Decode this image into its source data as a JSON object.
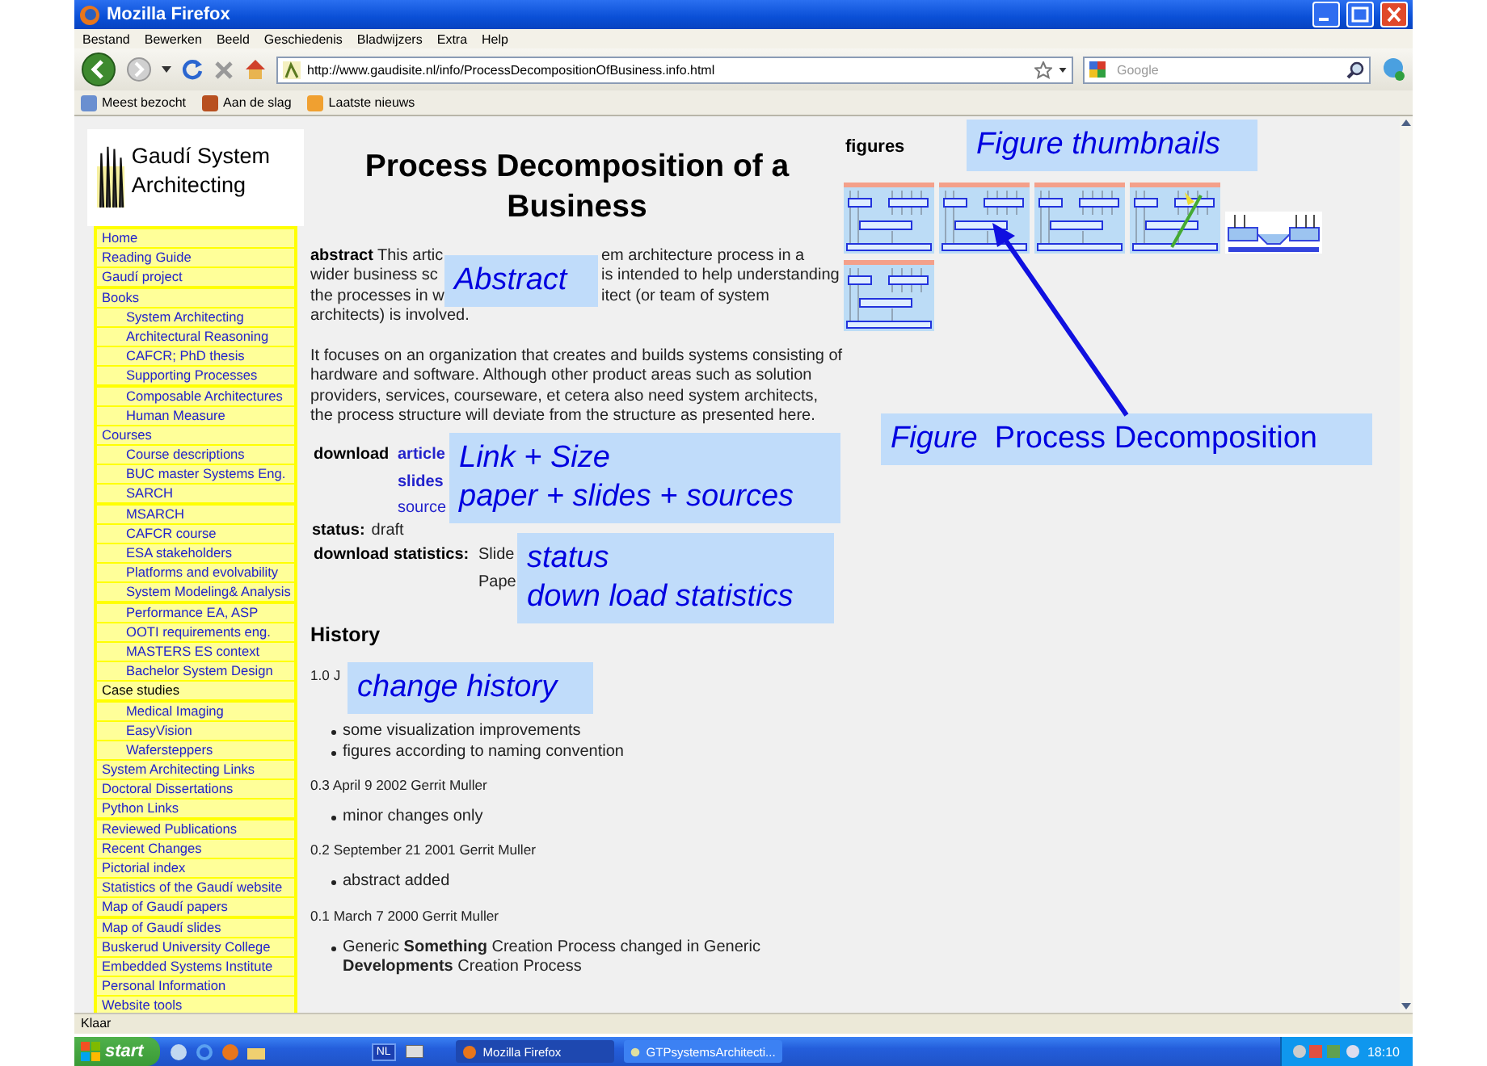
{
  "window": {
    "title": "Mozilla Firefox"
  },
  "menu": [
    "Bestand",
    "Bewerken",
    "Beeld",
    "Geschiedenis",
    "Bladwijzers",
    "Extra",
    "Help"
  ],
  "address": {
    "value": "http://www.gaudisite.nl/info/ProcessDecompositionOfBusiness.info.html"
  },
  "search": {
    "placeholder": "Google"
  },
  "bookmarks": [
    "Meest bezocht",
    "Aan de slag",
    "Laatste nieuws"
  ],
  "sidebar": {
    "logo_text": "Gaudí System Architecting",
    "items": [
      {
        "label": "Home",
        "kind": "link"
      },
      {
        "label": "Reading Guide",
        "kind": "link"
      },
      {
        "label": "Gaudí project",
        "kind": "link"
      },
      {
        "label": "Books",
        "kind": "link",
        "children": [
          {
            "label": "System Architecting",
            "kind": "link"
          },
          {
            "label": "Architectural Reasoning",
            "kind": "link"
          },
          {
            "label": "CAFCR; PhD thesis",
            "kind": "link"
          },
          {
            "label": "Supporting Processes",
            "kind": "link"
          },
          {
            "label": "Composable Architectures",
            "kind": "link"
          },
          {
            "label": "Human Measure",
            "kind": "link"
          }
        ]
      },
      {
        "label": "Courses",
        "kind": "link",
        "children": [
          {
            "label": "Course descriptions",
            "kind": "link"
          },
          {
            "label": "BUC master Systems Eng.",
            "kind": "link"
          },
          {
            "label": "SARCH",
            "kind": "link"
          },
          {
            "label": "MSARCH",
            "kind": "link"
          },
          {
            "label": "CAFCR course",
            "kind": "link"
          },
          {
            "label": "ESA stakeholders",
            "kind": "link"
          },
          {
            "label": "Platforms and evolvability",
            "kind": "link"
          },
          {
            "label": "System Modeling& Analysis",
            "kind": "link"
          },
          {
            "label": "Performance EA, ASP",
            "kind": "link"
          },
          {
            "label": "OOTI requirements eng.",
            "kind": "link"
          },
          {
            "label": "MASTERS ES context",
            "kind": "link"
          },
          {
            "label": "Bachelor System Design",
            "kind": "link"
          }
        ]
      },
      {
        "label": "Case studies",
        "kind": "text",
        "children": [
          {
            "label": "Medical Imaging",
            "kind": "link"
          },
          {
            "label": "EasyVision",
            "kind": "link"
          },
          {
            "label": "Wafersteppers",
            "kind": "link"
          }
        ]
      },
      {
        "label": "System Architecting Links",
        "kind": "link"
      },
      {
        "label": "Doctoral Dissertations",
        "kind": "link"
      },
      {
        "label": "Python Links",
        "kind": "link"
      },
      {
        "label": "Reviewed Publications",
        "kind": "link"
      },
      {
        "label": "Recent Changes",
        "kind": "link"
      },
      {
        "label": "Pictorial index",
        "kind": "link"
      },
      {
        "label": "Statistics of the Gaudí website",
        "kind": "link"
      },
      {
        "label": "Map of Gaudí papers",
        "kind": "link"
      },
      {
        "label": "Map of Gaudí slides",
        "kind": "link"
      },
      {
        "label": "Buskerud University College",
        "kind": "link"
      },
      {
        "label": "Embedded Systems Institute",
        "kind": "link"
      },
      {
        "label": "Personal Information",
        "kind": "link"
      },
      {
        "label": "Website tools",
        "kind": "link"
      }
    ]
  },
  "article": {
    "title": "Process Decomposition of a Business",
    "abstract": {
      "label": "abstract",
      "lines": [
        [
          "This artic",
          "em architecture process in a"
        ],
        [
          "wider business sc",
          "is intended to help understanding"
        ],
        [
          "the processes in w",
          "itect (or team of system"
        ],
        [
          "architects) is involved."
        ]
      ]
    },
    "paragraph": "It focuses on an organization that creates and builds systems consisting of hardware and software. Although other product areas such as solution providers, services, courseware, et cetera also need system architects, the process structure will deviate from the structure as presented here.",
    "download": {
      "label": "download",
      "links": [
        {
          "text": "article",
          "bold": true
        },
        {
          "text": "slides",
          "bold": true
        },
        {
          "text": "source",
          "bold": false
        }
      ]
    },
    "status": {
      "label": "status:",
      "value": "draft"
    },
    "download_statistics": {
      "label": "download statistics:",
      "values": [
        "Slide",
        "Pape"
      ]
    },
    "history": {
      "title": "History",
      "entries": [
        {
          "heading": "1.0 J",
          "items": [
            {
              "text": "some visualization improvements"
            },
            {
              "text": "figures according to naming convention"
            }
          ]
        },
        {
          "heading": "0.3 April 9 2002 Gerrit Muller",
          "items": [
            {
              "text": "minor changes only"
            }
          ]
        },
        {
          "heading": "0.2 September 21 2001 Gerrit Muller",
          "items": [
            {
              "text": "abstract added"
            }
          ]
        },
        {
          "heading": "0.1 March 7 2000 Gerrit Muller",
          "items": [
            {
              "text": "Generic **Something** Creation Process changed in Generic **Developments** Creation Process"
            }
          ]
        }
      ]
    }
  },
  "figures": {
    "title": "figures",
    "thumbnails": [
      {
        "kind": "diagram"
      },
      {
        "kind": "diagram"
      },
      {
        "kind": "diagram"
      },
      {
        "kind": "annotated"
      },
      {
        "kind": "wide"
      },
      {
        "kind": "diagram"
      }
    ]
  },
  "status_bar": "Klaar",
  "callouts": [
    {
      "lines": [
        "Abstract"
      ]
    },
    {
      "lines": [
        "Link + Size",
        "paper + slides + sources"
      ]
    },
    {
      "lines": [
        "status",
        "down load statistics"
      ]
    },
    {
      "lines": [
        "change history"
      ]
    },
    {
      "lines": [
        "Figure thumbnails"
      ]
    },
    {
      "lines": [
        "*Figure*  Process Decomposition"
      ]
    }
  ],
  "taskbar": {
    "start": "start",
    "language": "NL",
    "tasks": [
      {
        "label": "Mozilla Firefox",
        "selected": true
      },
      {
        "label": "GTPsystemsArchitecti...",
        "selected": false
      }
    ],
    "clock": "18:10"
  }
}
